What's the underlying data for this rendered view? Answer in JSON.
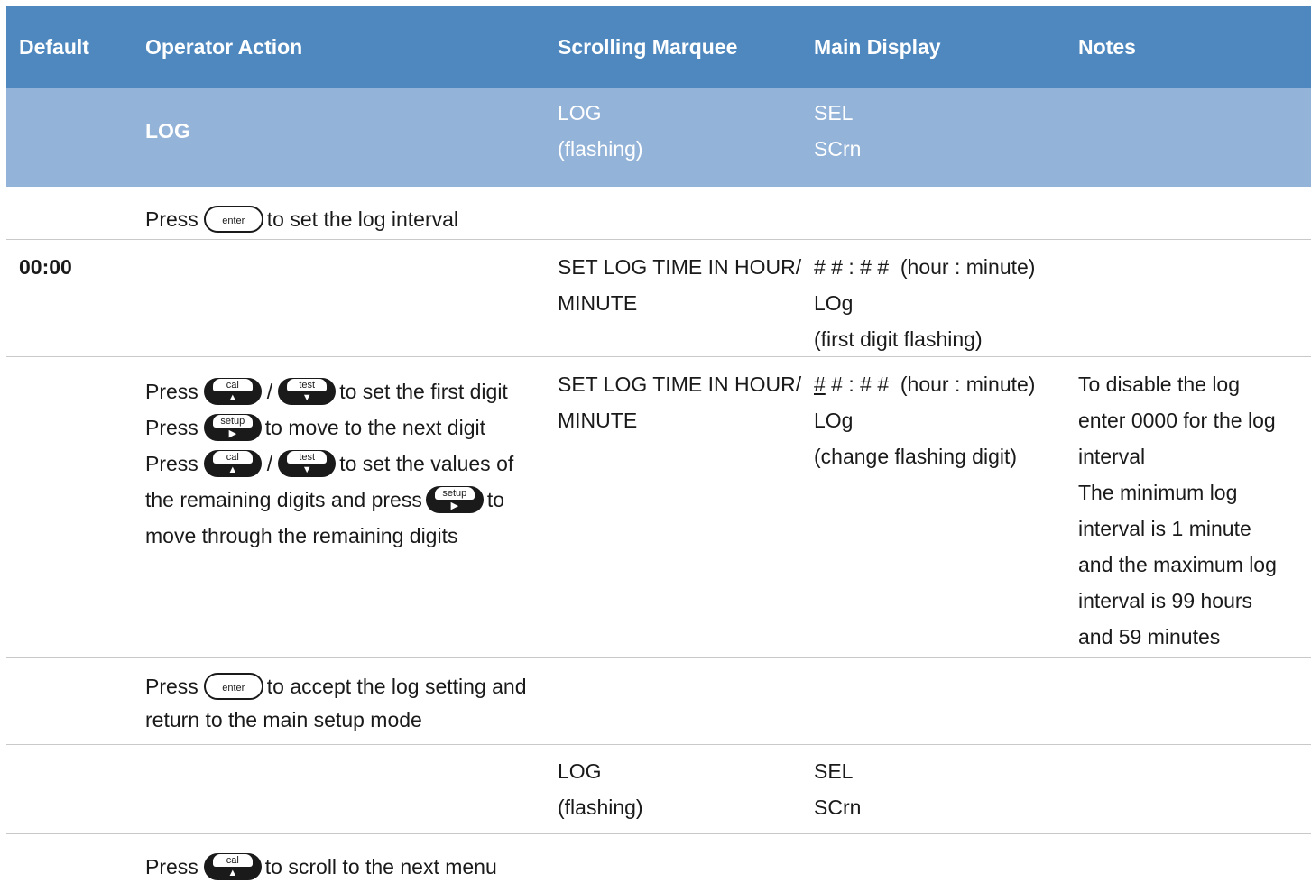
{
  "header": {
    "default": "Default",
    "operator_action": "Operator Action",
    "scrolling_marquee": "Scrolling Marquee",
    "main_display": "Main Display",
    "notes": "Notes"
  },
  "section": {
    "action": "LOG",
    "marquee_1": "LOG",
    "marquee_2": "(flashing)",
    "main_1": "SEL",
    "main_2": "SCrn"
  },
  "keys": {
    "enter": "enter",
    "cal": "cal",
    "test": "test",
    "setup": "setup"
  },
  "row1": {
    "press": "Press",
    "text": "to set the log interval"
  },
  "row2": {
    "default": "00:00",
    "marquee_1": "SET LOG TIME IN HOUR/",
    "marquee_2": "MINUTE",
    "main_1": "# # : # #  (hour : minute)",
    "main_2": "LOg",
    "main_3": "(first digit flashing)"
  },
  "row3": {
    "press": "Press",
    "slash": "/",
    "line1_text": "to set the first digit",
    "line2_text": "to move to the next digit",
    "line3_text": "to set the values of",
    "line4_text": "the remaining digits and press",
    "line4_end": "to",
    "line5": "move through the remaining digits",
    "marquee_1": "SET LOG TIME IN HOUR/",
    "marquee_2": "MINUTE",
    "main_first": "#",
    "main_1_rest": " # : # #  (hour : minute)",
    "main_2": "LOg",
    "main_3": "(change flashing digit)",
    "notes": [
      "To disable the log",
      "enter 0000 for the log",
      "interval",
      "The minimum log",
      "interval is 1 minute",
      "and the maximum log",
      "interval is 99 hours",
      "and 59 minutes"
    ]
  },
  "row4": {
    "press": "Press",
    "text": "to accept the log setting and",
    "line2": "return to the main setup mode"
  },
  "row5": {
    "marquee_1": "LOG",
    "marquee_2": "(flashing)",
    "main_1": "SEL",
    "main_2": "SCrn"
  },
  "row6": {
    "press": "Press",
    "text": "to scroll to the next menu"
  },
  "colors": {
    "header_bg": "#4e88bf",
    "section_bg": "#93b3d8",
    "divider": "#c9c9c9"
  }
}
